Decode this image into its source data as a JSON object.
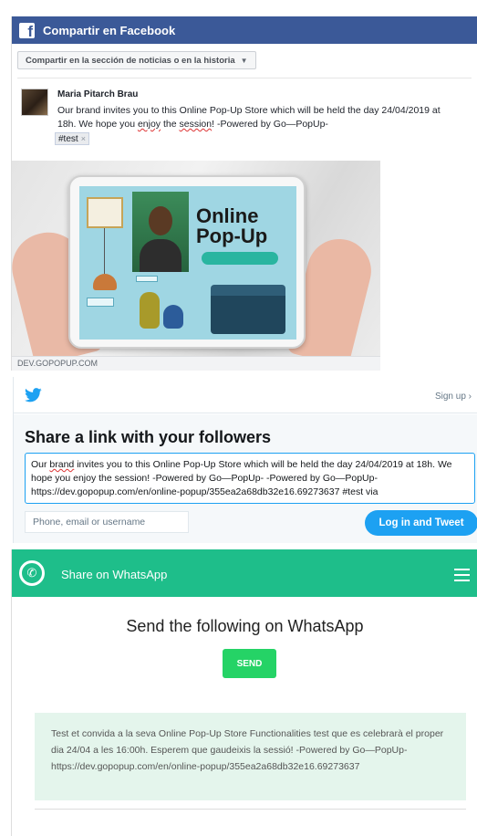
{
  "facebook": {
    "header_title": "Compartir en Facebook",
    "share_target": "Compartir en la sección de noticias o en la historia",
    "author": "Maria Pitarch Brau",
    "post_line1": "Our brand invites you to this Online Pop-Up Store  which will be held the day 24/04/2019 at",
    "post_line2_a": "18h. We hope you ",
    "post_line2_sq": "enjoy",
    "post_line2_b": " the ",
    "post_line2_sq2": "session",
    "post_line2_c": "! -Powered by Go—PopUp-",
    "hashtag": "#test",
    "image_title": "Online Pop-Up",
    "domain": "DEV.GOPOPUP.COM"
  },
  "twitter": {
    "signup": "Sign up ›",
    "title": "Share a link with your followers",
    "tweet_a": "Our ",
    "tweet_sq": "brand",
    "tweet_b": " invites you to this Online Pop-Up Store  which will be held the day 24/04/2019 at 18h. We hope you enjoy the session! -Powered by Go—PopUp- -Powered by Go—PopUp- https://dev.gopopup.com/en/online-popup/355ea2a68db32e16.69273637 #test via",
    "username_placeholder": "Phone, email or username",
    "login_button": "Log in and Tweet"
  },
  "whatsapp": {
    "header_title": "Share on WhatsApp",
    "heading": "Send the following on WhatsApp",
    "send_button": "SEND",
    "message": "Test et convida a la seva Online Pop-Up Store Functionalities test que es celebrarà el proper dia 24/04 a les 16:00h. Esperem que gaudeixis la sessió! -Powered by Go—PopUp- https://dev.gopopup.com/en/online-popup/355ea2a68db32e16.69273637"
  },
  "colors": {
    "facebook_blue": "#3b5998",
    "twitter_blue": "#1da1f2",
    "whatsapp_green": "#1ebe8a",
    "whatsapp_send": "#25d366"
  },
  "icons": {
    "facebook": "facebook-logo-icon",
    "twitter": "twitter-bird-icon",
    "whatsapp": "whatsapp-logo-icon",
    "menu": "hamburger-menu-icon"
  }
}
